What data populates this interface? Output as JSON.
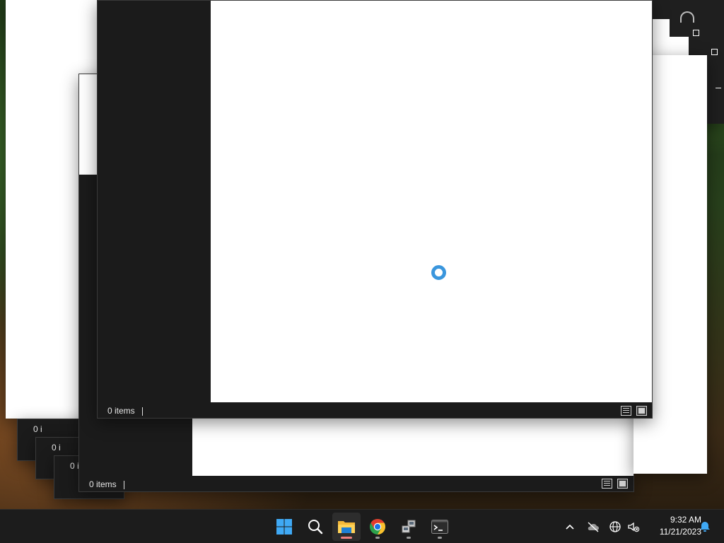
{
  "windows": {
    "front": {
      "status_text": "0 items"
    },
    "middle": {
      "status_text": "0 items"
    },
    "stacked_labels": [
      "0 i",
      "0 i",
      "0 i"
    ]
  },
  "taskbar": {
    "apps": [
      {
        "name": "Start",
        "icon": "windows-logo-icon",
        "state": "none"
      },
      {
        "name": "Search",
        "icon": "search-icon",
        "state": "none"
      },
      {
        "name": "File Explorer",
        "icon": "folder-icon",
        "state": "active"
      },
      {
        "name": "Google Chrome",
        "icon": "chrome-icon",
        "state": "running"
      },
      {
        "name": "Network tool",
        "icon": "network-computers-icon",
        "state": "running"
      },
      {
        "name": "Terminal",
        "icon": "terminal-icon",
        "state": "running"
      }
    ],
    "tray": {
      "icons": [
        "chevron-up-icon",
        "cloud-offline-icon",
        "globe-icon",
        "speaker-muted-icon"
      ],
      "time": "9:32 AM",
      "date": "11/21/2023",
      "notification_icon": "bell-icon"
    }
  },
  "colors": {
    "window_dark": "#1b1b1b",
    "content_white": "#ffffff",
    "taskbar": "#1c1c1c",
    "accent_blue": "#3a96dd",
    "active_indicator": "#f08080"
  }
}
